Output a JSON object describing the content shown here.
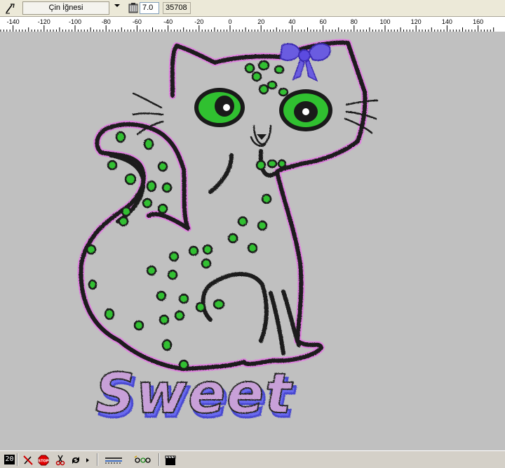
{
  "toolbar": {
    "needle_select": "Çin İğnesi",
    "density_value": "7.0",
    "stitch_count": "35708"
  },
  "ruler": {
    "ticks": [
      "-140",
      "-120",
      "-100",
      "-80",
      "-60",
      "-40",
      "-20",
      "0",
      "20",
      "40",
      "60",
      "80",
      "100",
      "120",
      "140",
      "160"
    ]
  },
  "canvas": {
    "design_text": "Sweet",
    "colors": {
      "background": "#c0c0c0",
      "outline": "#1a1a1a",
      "outline_halo": "#e080e0",
      "spots": "#30c030",
      "bow": "#6a5be0",
      "text_fill": "#c8a0d8",
      "text_shadow": "#6a6af0"
    }
  },
  "statusbar": {
    "number_badge": "20",
    "stop_label": "STOP"
  }
}
